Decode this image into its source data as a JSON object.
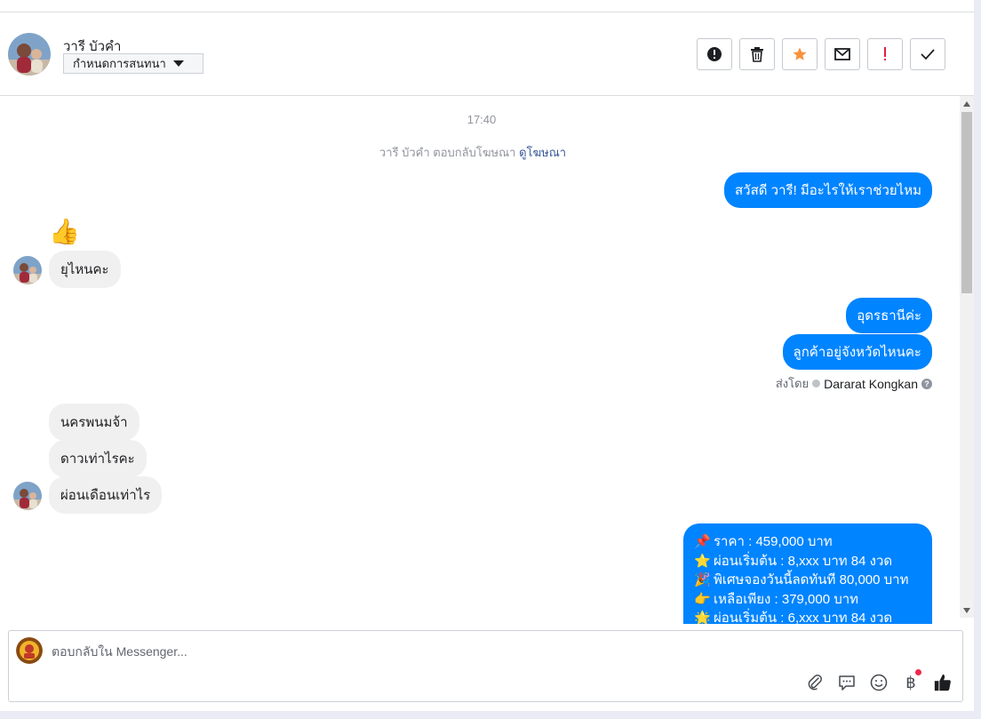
{
  "header": {
    "contact_name": "วารี บัวคำ",
    "assign_label": "กำหนดการสนทนา",
    "actions": [
      {
        "name": "report-spam-button",
        "icon": "alert-circle-icon"
      },
      {
        "name": "delete-button",
        "icon": "trash-icon"
      },
      {
        "name": "star-button",
        "icon": "star-icon"
      },
      {
        "name": "mark-unread-button",
        "icon": "envelope-icon"
      },
      {
        "name": "follow-up-button",
        "icon": "exclamation-icon"
      },
      {
        "name": "mark-done-button",
        "icon": "check-icon"
      }
    ],
    "star_color": "#f7923b",
    "exclaim_color": "#e41e3f"
  },
  "thread": {
    "time": "17:40",
    "system_text": "วารี บัวคำ ตอบกลับโฆษณา",
    "system_link": "ดูโฆษณา",
    "messages": {
      "out_greeting": "สวัสดี วารี! มีอะไรให้เราช่วยไหม",
      "in_thumbs": "👍",
      "in_where": "ยุไหนคะ",
      "out_location": "อุดรธานีค่ะ",
      "out_question": "ลูกค้าอยู่จังหวัดไหนคะ",
      "sender_prefix": "ส่งโดย",
      "sender_name": "Dararat Kongkan",
      "in_city": "นครพนมจ้า",
      "in_down": "ดาวเท่าไรคะ",
      "in_installment": "ผ่อนเดือนเท่าไร",
      "promo_lines": [
        {
          "emoji": "📌",
          "text": "ราคา : 459,000 บาท"
        },
        {
          "emoji": "⭐",
          "text": "ผ่อนเริ่มต้น : 8,xxx บาท 84 งวด"
        },
        {
          "emoji": "🎉",
          "text": "พิเศษจองวันนี้ลดทันที 80,000 บาท"
        },
        {
          "emoji": "👉",
          "text": "เหลือเพียง : 379,000 บาท"
        },
        {
          "emoji": "🌟",
          "text": "ผ่อนเริ่มต้น : 6,xxx บาท 84 งวด"
        }
      ]
    },
    "accent": "#0084ff"
  },
  "composer": {
    "placeholder": "ตอบกลับใน Messenger...",
    "tools": [
      "paperclip-icon",
      "speech-bubble-icon",
      "smiley-icon",
      "baht-icon",
      "thumbs-up-icon"
    ],
    "baht_symbol": "฿"
  }
}
